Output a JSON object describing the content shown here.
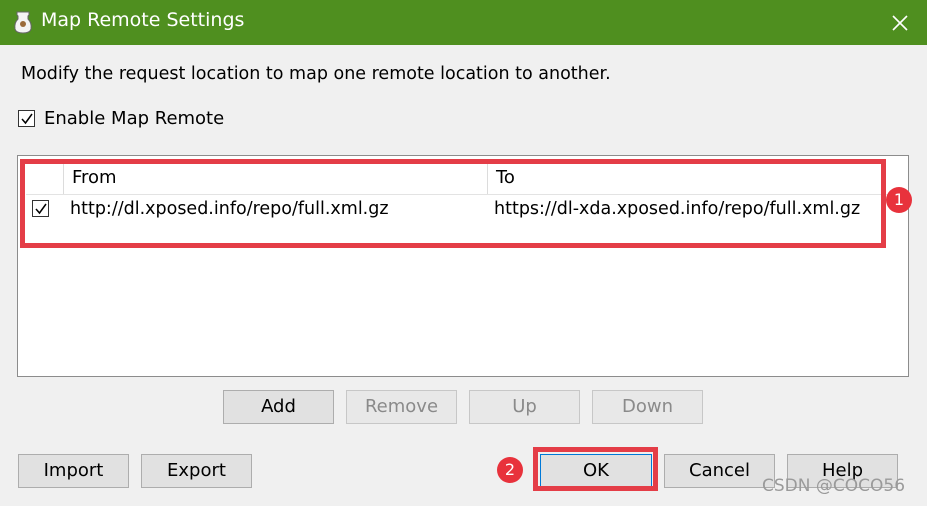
{
  "window": {
    "title": "Map Remote Settings",
    "titlebar_color": "#4f8f1f"
  },
  "description": "Modify the request location to map one remote location to another.",
  "enable": {
    "label": "Enable Map Remote",
    "checked": true
  },
  "table": {
    "columns": [
      "From",
      "To"
    ],
    "rows": [
      {
        "checked": true,
        "from": "http://dl.xposed.info/repo/full.xml.gz",
        "to": "https://dl-xda.xposed.info/repo/full.xml.gz"
      }
    ]
  },
  "table_buttons": {
    "add": "Add",
    "remove": "Remove",
    "up": "Up",
    "down": "Down"
  },
  "footer": {
    "import": "Import",
    "export": "Export",
    "ok": "OK",
    "cancel": "Cancel",
    "help": "Help"
  },
  "annotations": {
    "badge1": "1",
    "badge2": "2",
    "color": "#e43d47"
  },
  "watermark": "CSDN @COCO56"
}
